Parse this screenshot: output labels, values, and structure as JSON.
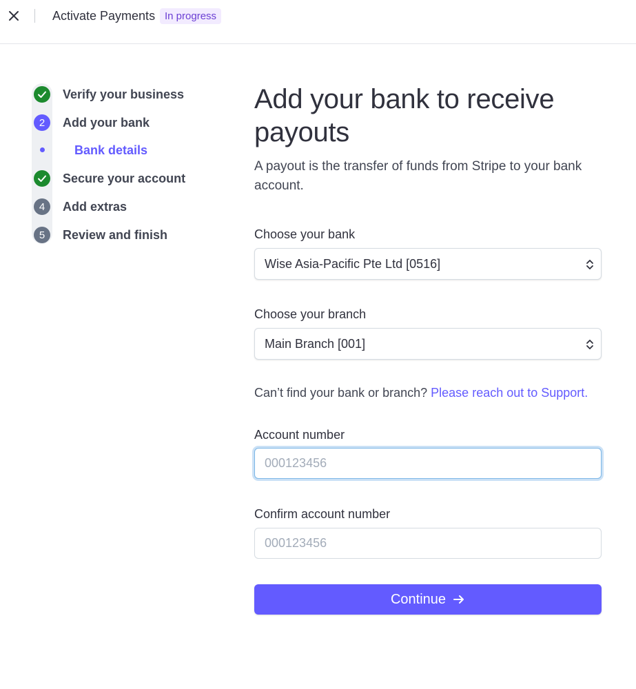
{
  "topbar": {
    "title": "Activate Payments",
    "status_badge": "In progress"
  },
  "stepper": {
    "steps": [
      {
        "label": "Verify your business",
        "state": "done",
        "marker": "check-icon"
      },
      {
        "label": "Add your bank",
        "state": "active",
        "marker": "2"
      },
      {
        "label": "Secure your account",
        "state": "done",
        "marker": "check-icon"
      },
      {
        "label": "Add extras",
        "state": "pending",
        "marker": "4"
      },
      {
        "label": "Review and finish",
        "state": "pending",
        "marker": "5"
      }
    ],
    "substep": {
      "label": "Bank details"
    }
  },
  "main": {
    "headline": "Add your bank to receive payouts",
    "subtitle": "A payout is the transfer of funds from Stripe to your bank account.",
    "bank_select": {
      "label": "Choose your bank",
      "value": "Wise Asia-Pacific Pte Ltd [0516]"
    },
    "branch_select": {
      "label": "Choose your branch",
      "value": "Main Branch [001]"
    },
    "help": {
      "text": "Can’t find your bank or branch? ",
      "link": "Please reach out to Support."
    },
    "account_number": {
      "label": "Account number",
      "placeholder": "000123456"
    },
    "confirm_account_number": {
      "label": "Confirm account number",
      "placeholder": "000123456"
    },
    "continue_label": "Continue"
  },
  "colors": {
    "accent": "#635bff",
    "success": "#1c8a2e",
    "pending": "#687385",
    "badge_bg": "#f2ebff",
    "badge_text": "#6b3fd4"
  }
}
